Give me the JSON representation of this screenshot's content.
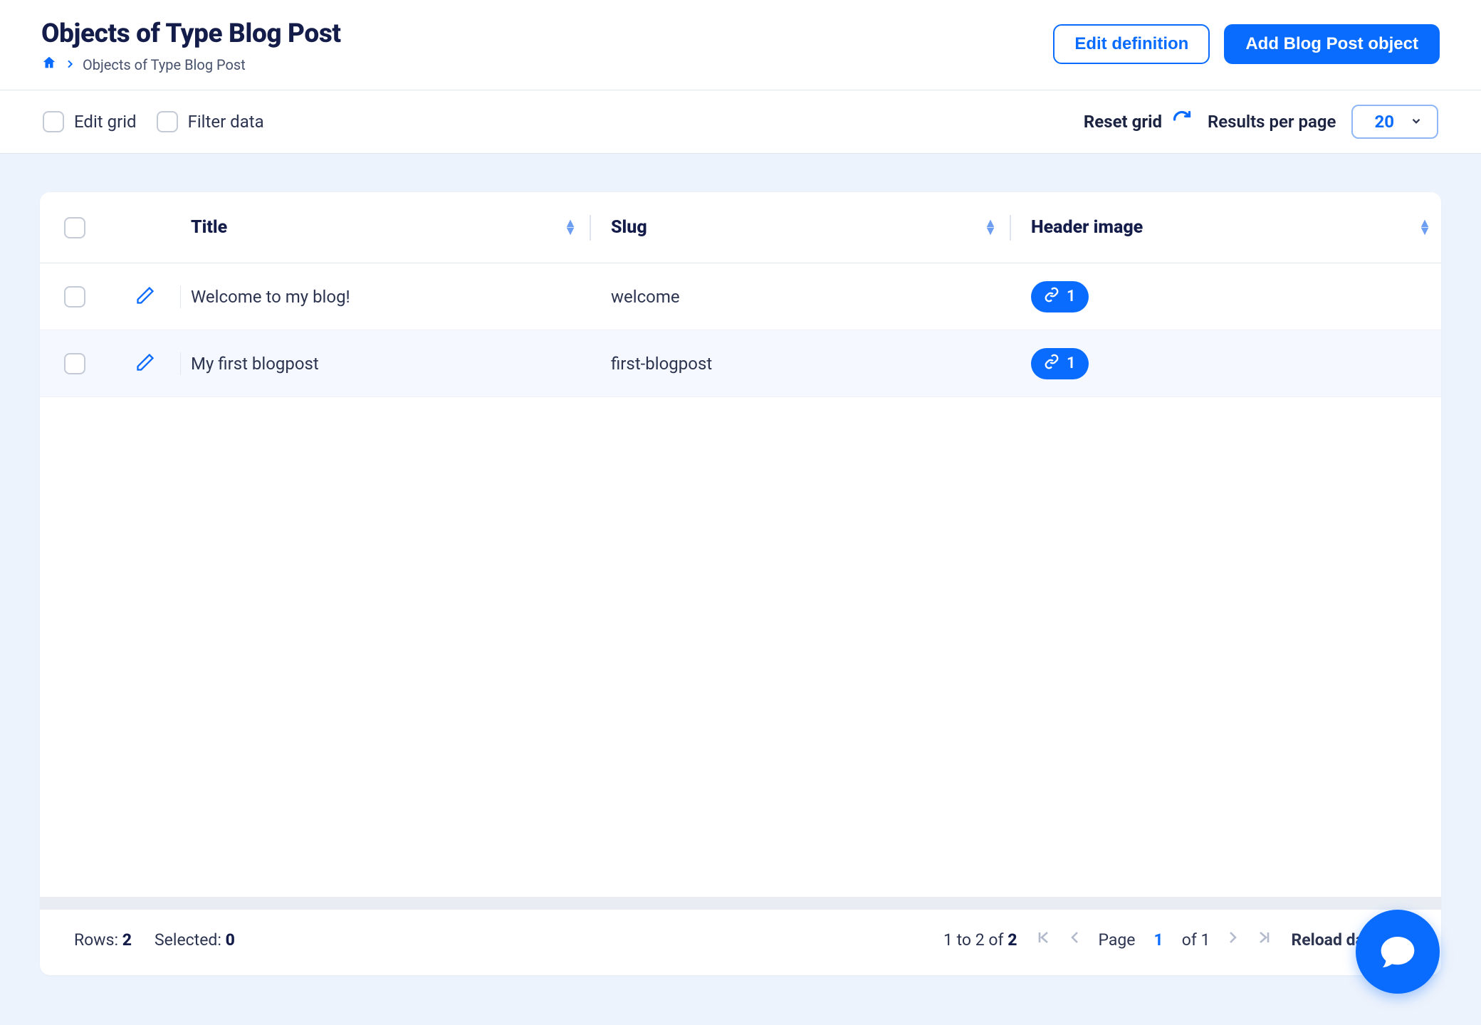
{
  "header": {
    "title": "Objects of Type Blog Post",
    "breadcrumb": "Objects of Type Blog Post",
    "edit_definition_label": "Edit definition",
    "add_object_label": "Add Blog Post object"
  },
  "toolbar": {
    "edit_grid_label": "Edit grid",
    "filter_data_label": "Filter data",
    "reset_grid_label": "Reset grid",
    "results_per_page_label": "Results per page",
    "results_per_page_value": "20"
  },
  "columns": {
    "title": "Title",
    "slug": "Slug",
    "header_image": "Header image"
  },
  "rows": [
    {
      "title": "Welcome to my blog!",
      "slug": "welcome",
      "header_image_count": "1"
    },
    {
      "title": "My first blogpost",
      "slug": "first-blogpost",
      "header_image_count": "1"
    }
  ],
  "footer": {
    "rows_label": "Rows:",
    "rows_value": "2",
    "selected_label": "Selected:",
    "selected_value": "0",
    "range_prefix": "1 to 2 of",
    "range_total": "2",
    "page_label": "Page",
    "page_current": "1",
    "page_of": "of 1",
    "reload_label": "Reload data"
  }
}
